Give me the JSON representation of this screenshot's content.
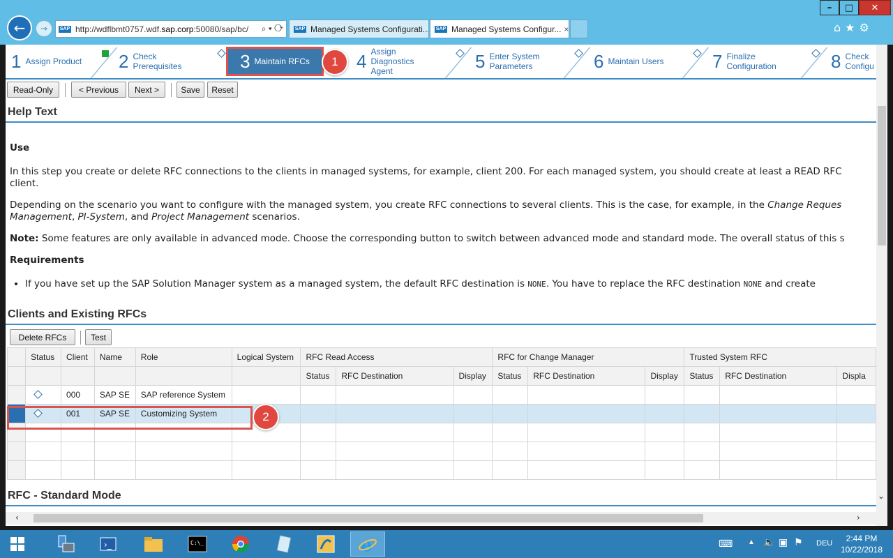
{
  "browser": {
    "url_prefix": "http://wdflbmt0757.wdf.",
    "url_bold": "sap.corp",
    "url_suffix": ":50080/sap/bc/",
    "address_tools": "⌕ ▾ ⟳",
    "tabs": [
      {
        "title": "Managed Systems Configurati..."
      },
      {
        "title": "Managed Systems Configur...",
        "close": "×"
      }
    ]
  },
  "roadmap": {
    "steps": [
      {
        "num": "1",
        "label1": "Assign Product",
        "label2": ""
      },
      {
        "num": "2",
        "label1": "Check",
        "label2": "Prerequisites"
      },
      {
        "num": "3",
        "label1": "Maintain RFCs",
        "label2": ""
      },
      {
        "num": "4",
        "label1": "Assign",
        "label2": "Diagnostics",
        "label3": "Agent"
      },
      {
        "num": "5",
        "label1": "Enter System",
        "label2": "Parameters"
      },
      {
        "num": "6",
        "label1": "Maintain Users",
        "label2": ""
      },
      {
        "num": "7",
        "label1": "Finalize",
        "label2": "Configuration"
      },
      {
        "num": "8",
        "label1": "Check",
        "label2": "Configu"
      }
    ]
  },
  "callouts": {
    "one": "1",
    "two": "2"
  },
  "toolbar": {
    "read_only": "Read-Only",
    "previous": "< Previous",
    "next": "Next >",
    "save": "Save",
    "reset": "Reset"
  },
  "help": {
    "section_title": "Help Text",
    "use_heading": "Use",
    "p1": "In this step you create or delete RFC connections to the clients in managed systems, for example, client 200. For each managed system, you should create at least a READ RFC",
    "p1b": "client.",
    "p2_start": "Depending on the scenario you want to configure with the managed system, you create RFC connections to several clients. This is the case, for example, in the ",
    "p2_italic1": "Change Reques",
    "p2_italic2": "Management",
    "p2_comma": ", ",
    "p2_italic3": "PI-System",
    "p2_and": ", and ",
    "p2_italic4": "Project Management",
    "p2_end": " scenarios.",
    "note_label": "Note:",
    "note_text": " Some features are only available in advanced mode. Choose the corresponding button to switch between advanced mode and standard mode. The overall status of this s",
    "req_heading": "Requirements",
    "req1_a": "If you have set up the SAP Solution Manager system as a managed system, the default RFC destination is ",
    "req1_none1": "NONE",
    "req1_b": ". You have to replace the RFC destination ",
    "req1_none2": "NONE",
    "req1_c": " and create"
  },
  "clients": {
    "section_title": "Clients and Existing RFCs",
    "delete_btn": "Delete RFCs",
    "test_btn": "Test",
    "headers": {
      "status": "Status",
      "client": "Client",
      "name": "Name",
      "role": "Role",
      "logical": "Logical System",
      "read_access": "RFC Read Access",
      "change_manager": "RFC for Change Manager",
      "trusted": "Trusted System RFC",
      "sub_status": "Status",
      "sub_dest": "RFC Destination",
      "sub_display": "Display",
      "sub_display_cut": "Displa"
    },
    "rows": [
      {
        "client": "000",
        "name": "SAP SE",
        "role": "SAP reference System"
      },
      {
        "client": "001",
        "name": "SAP SE",
        "role": "Customizing System"
      }
    ]
  },
  "rfc_section": {
    "title": "RFC - Standard Mode"
  },
  "taskbar": {
    "lang": "DEU",
    "time": "2:44 PM",
    "date": "10/22/2018"
  }
}
